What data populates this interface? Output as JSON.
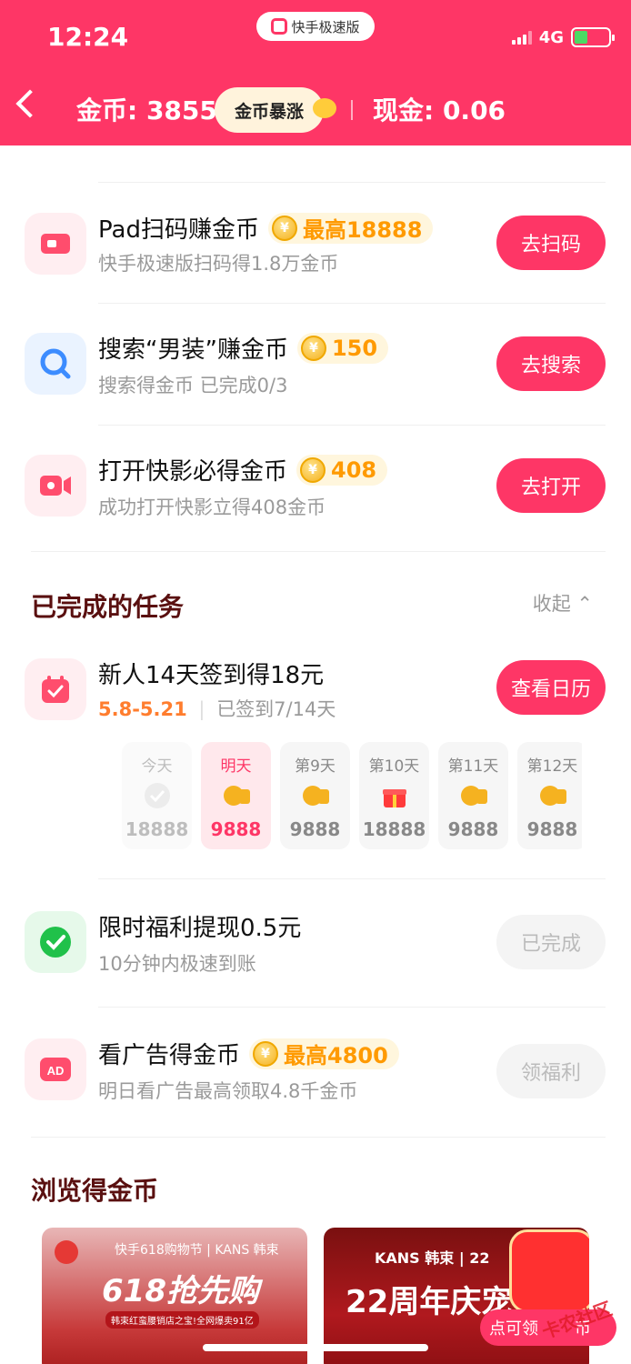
{
  "status": {
    "time": "12:24",
    "network": "4G",
    "app_pill": "快手极速版"
  },
  "header": {
    "coins": "金币: 38551",
    "boost": "金币暴涨",
    "cash": "现金: 0.06"
  },
  "tasks": [
    {
      "title": "Pad扫码赚金币",
      "reward": "最高18888",
      "subtitle": "快手极速版扫码得1.8万金币",
      "button": "去扫码",
      "icon": "tv-icon",
      "color": "#ffeef1"
    },
    {
      "title": "搜索“男装”赚金币",
      "reward": "150",
      "subtitle": "搜索得金币 已完成0/3",
      "button": "去搜索",
      "icon": "search-icon",
      "color": "#eaf3ff"
    },
    {
      "title": "打开快影必得金币",
      "reward": "408",
      "subtitle": "成功打开快影立得408金币",
      "button": "去打开",
      "icon": "video-camera-icon",
      "color": "#ffeef1"
    }
  ],
  "completed": {
    "title": "已完成的任务",
    "collapse": "收起"
  },
  "checkin": {
    "title": "新人14天签到得18元",
    "date_range": "5.8-5.21",
    "progress": "已签到7/14天",
    "button": "查看日历"
  },
  "days": [
    {
      "label": "今天",
      "value": "18888",
      "icon": "check-icon"
    },
    {
      "label": "明天",
      "value": "9888",
      "icon": "coin-stack-icon"
    },
    {
      "label": "第9天",
      "value": "9888",
      "icon": "coin-stack-icon"
    },
    {
      "label": "第10天",
      "value": "18888",
      "icon": "gift-icon"
    },
    {
      "label": "第11天",
      "value": "9888",
      "icon": "coin-stack-icon"
    },
    {
      "label": "第12天",
      "value": "9888",
      "icon": "coin-stack-icon"
    }
  ],
  "done_tasks": [
    {
      "title": "限时福利提现0.5元",
      "subtitle": "10分钟内极速到账",
      "button": "已完成",
      "icon": "wechat-pay-icon"
    },
    {
      "title": "看广告得金币",
      "reward": "最高4800",
      "subtitle": "明日看广告最高领取4.8千金币",
      "button": "领福利",
      "icon": "ad-icon"
    }
  ],
  "browse": {
    "title": "浏览得金币",
    "card1": {
      "brand": "快手618购物节 | KANS 韩束",
      "headline": "618抢先购",
      "tagline": "韩束红蛮腰销店之宝!全网爆卖91亿"
    },
    "card2": {
      "brand": "KANS 韩束 | 22",
      "headline": "22周年庆宠",
      "cta": "点可领",
      "cta2": "币"
    }
  },
  "watermark": "卡农社区"
}
